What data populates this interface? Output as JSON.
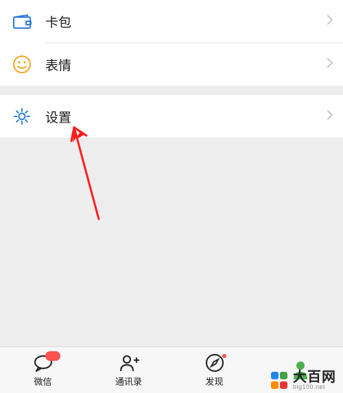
{
  "list": {
    "card_pack": {
      "label": "卡包",
      "icon": "wallet-icon",
      "color": "#2a7bdd"
    },
    "stickers": {
      "label": "表情",
      "icon": "smiley-icon",
      "color": "#f5a623"
    },
    "settings": {
      "label": "设置",
      "icon": "gear-icon",
      "color": "#2a7bdd"
    }
  },
  "tabs": {
    "wechat": {
      "label": "微信",
      "icon": "chat-icon",
      "badge": true,
      "badge_fill": true
    },
    "contacts": {
      "label": "通讯录",
      "icon": "contacts-icon",
      "badge": false
    },
    "discover": {
      "label": "发现",
      "icon": "compass-icon",
      "badge": true,
      "badge_fill": false
    },
    "me": {
      "label": "",
      "icon": "person-icon",
      "active": true
    }
  },
  "annotation": {
    "color": "#ff1e1e"
  },
  "watermark": {
    "text_cn": "大百网",
    "text_en": "big100.net",
    "colors": [
      "#1e88e5",
      "#43a047",
      "#fb8c00",
      "#e53935"
    ]
  },
  "tab_icon_color": "#2b2b2b",
  "active_tab_color": "#4caf50"
}
